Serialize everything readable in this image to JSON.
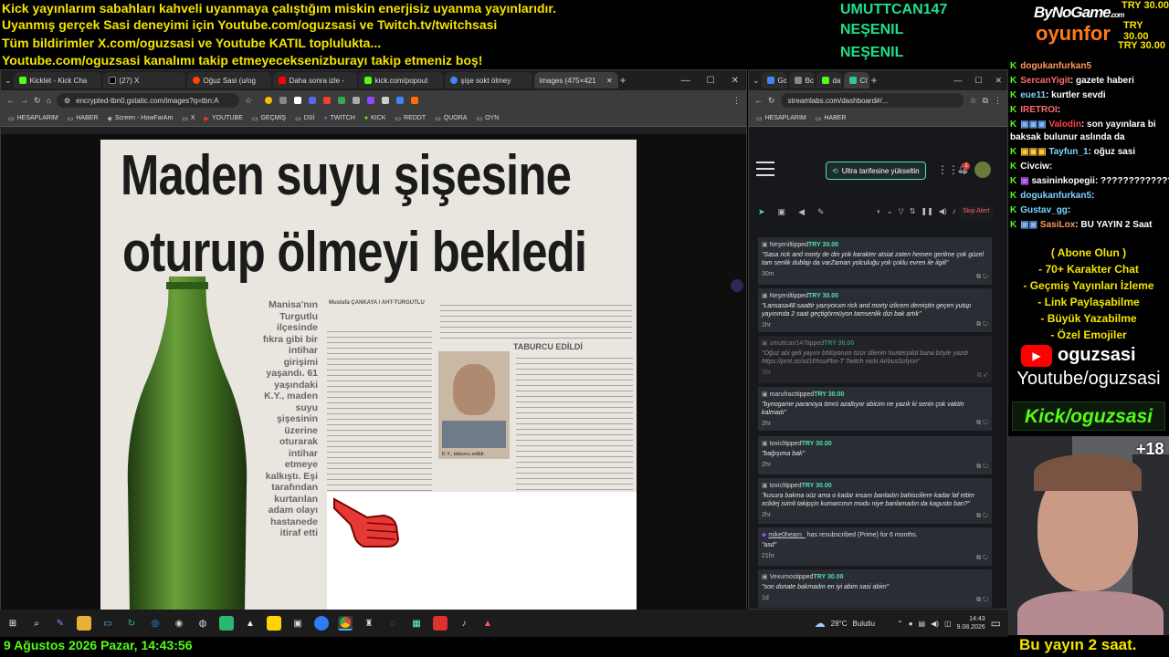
{
  "overlay": {
    "ticker_lines": [
      "Kick yayınlarım sabahları kahveli uyanmaya çalıştığım miskin enerjisiz uyanma yayınlarıdır.",
      "Uyanmış gerçek Sasi deneyimi için Youtube.com/oguzsasi ve Twitch.tv/twitchsasi",
      "Tüm bildirimler X.com/oguzsasi ve Youtube KATIL toplulukta...",
      "Youtube.com/oguzsasi kanalımı takip etmeyeceksenizburayı takip etmeniz boş!"
    ],
    "top_names": [
      "UMUTTCAN147",
      "NEŞENIL",
      "NEŞENIL"
    ],
    "sponsor_line1": "ByNoGame",
    "sponsor_com": ".com",
    "sponsor_line2": "oyunfor",
    "tips": [
      "TRY 30.00",
      "TRY 30.00",
      "TRY 30.00"
    ],
    "date_bar": "9 Ağustos 2026 Pazar, 14:43:56",
    "bottom_right": "Bu yayın 2 saat.",
    "viewer_count": "+18"
  },
  "left_browser": {
    "tabs": [
      "Kicklet - Kick Cha",
      "(27) X",
      "Oğuz Sasi (u/og",
      "Daha sonra izle -",
      "kick.com/popout",
      "şişe sokt ölmey",
      "images (475×421"
    ],
    "new_tab": "+",
    "url": "encrypted-tbn0.gstatic.com/images?q=tbn:A",
    "bookmarks": [
      "HESAPLARIM",
      "HABER",
      "Screen - HowFarAm",
      "X",
      "YOUTUBE",
      "GEÇMİŞ",
      "DSİ",
      "TWITCH",
      "KICK",
      "REDDT",
      "QUORA",
      "OYN"
    ]
  },
  "newspaper": {
    "headline_line1": "Maden suyu şişesine",
    "headline_line2": "oturup ölmeyi bekledi",
    "side_text": "Manisa'nın Turgutlu ilçesinde fıkra gibi bir intihar girişimi yaşandı. 61 yaşındaki K.Y., maden suyu şişesinin üzerine oturarak intihar etmeye kalkıştı. Eşi tarafından kurtarılan adam olayı hastanede itiraf etti",
    "byline": "Mustafa ÇANKAYA / AHT-TURGUTLU",
    "subhead": "TABURCU EDİLDİ",
    "photo_caption": "K.Y., taburcu edildi."
  },
  "right_browser": {
    "tabs": [
      "Gc",
      "Bc",
      "da",
      "Cl"
    ],
    "new_tab": "+",
    "url": "streamlabs.com/dashboard#/...",
    "bookmarks": [
      "HESAPLARIM",
      "HABER"
    ],
    "upgrade_button": "Ultra tarifesine yükseltin",
    "skip_alert": "Skip Alert",
    "notify_count": "1",
    "alerts": [
      {
        "name": "Neşenil",
        "action": "tipped",
        "amount": "TRY 30.00",
        "msg": "\"Sasa rick and morty de din yok karakter atsiat zaten hemen gerilme çok güzel tam senlik dublajı da varZaman yolculuğu yok çoklu evren ile ilgili\"",
        "time": "30m"
      },
      {
        "name": "Neşenil",
        "action": "tipped",
        "amount": "TRY 30.00",
        "msg": "\"Lansasa48 saattir yazıyorum rick and morty izlicem demiştin geçen yutup yayınında 2 saat geçtigörmüyon tamsenlik dizi bak artık\"",
        "time": "1hr"
      },
      {
        "name": "umuttcan147",
        "action": "tipped",
        "amount": "TRY 30.00",
        "msg": "\"Oğuz abi geli yayını bölüyorum özür dilerim hunterpilot bana böyle yazdı https://prnt.sc/sd1EhsuFbo-T Twitch nicki AirbusSofyon\"",
        "time": "1hr"
      },
      {
        "name": "marufract",
        "action": "tipped",
        "amount": "TRY 30.00",
        "msg": "\"bynogame paranoya ömrü azaltıyor abicim ne yazık ki senin çok vaktin kalmadı\"",
        "time": "2hr"
      },
      {
        "name": "toxicl",
        "action": "tipped",
        "amount": "TRY 30.00",
        "msg": "\"bağışıma bak\"",
        "time": "2hr"
      },
      {
        "name": "toxicl",
        "action": "tipped",
        "amount": "TRY 30.00",
        "msg": "\"kusura bakma oüz ama o kadar insanı banladın bahisciliere kadar laf ettim xclidej isimli takipçin kumarcının modu niye banlamadın da kagusto ban?\"",
        "time": "2hr"
      },
      {
        "name": "mike0hearn_",
        "action": "has resubscribed (Prime) for 6 months.",
        "amount": "",
        "msg": "\"asd\"",
        "time": "21hr"
      },
      {
        "name": "Vexumos",
        "action": "tipped",
        "amount": "TRY 30.00",
        "msg": "\"son donate bakmadın en iyi abim sasi abim\"",
        "time": "1d"
      }
    ]
  },
  "chat": [
    {
      "user": "dogukanfurkan5",
      "msg": ""
    },
    {
      "user": "SercanYigit",
      "msg": ": gazete haberi"
    },
    {
      "user": "eue11",
      "msg": ": kurtler sevdi"
    },
    {
      "user": "IRETROI",
      "msg": ":"
    },
    {
      "user": "Valodin",
      "msg": ": son yayınlara bi"
    },
    {
      "user": "",
      "msg": "baksak bulunur aslında da"
    },
    {
      "user": "Tayfun_1",
      "msg": ": oğuz sasi"
    },
    {
      "user": "Civciw",
      "msg": ":"
    },
    {
      "user": "sasininkopegii",
      "msg": ": ???????????????"
    },
    {
      "user": "dogukanfurkan5",
      "msg": ":"
    },
    {
      "user": "Gustav_gg",
      "msg": ":"
    },
    {
      "user": "SasiLox",
      "msg": ": BU YAYIN 2 Saat"
    }
  ],
  "info_panel": {
    "lines": [
      "( Abone Olun )",
      "- 70+ Karakter Chat",
      "- Geçmiş Yayınları İzleme",
      "- Link Paylaşabilme",
      "- Büyük Yazabilme",
      "- Özel Emojiler"
    ],
    "yt_name": "oguzsasi",
    "yt_url": "Youtube/oguzsasi",
    "kick_url": "Kick/oguzsasi"
  },
  "taskbar": {
    "weather": "28°C",
    "weather_desc": "Bulutlu",
    "time": "14:43",
    "date": "9.08.2026"
  },
  "colors": {
    "ticker": "#f5e400",
    "kick_green": "#53fc18",
    "accent_teal": "#4fe1b3"
  }
}
